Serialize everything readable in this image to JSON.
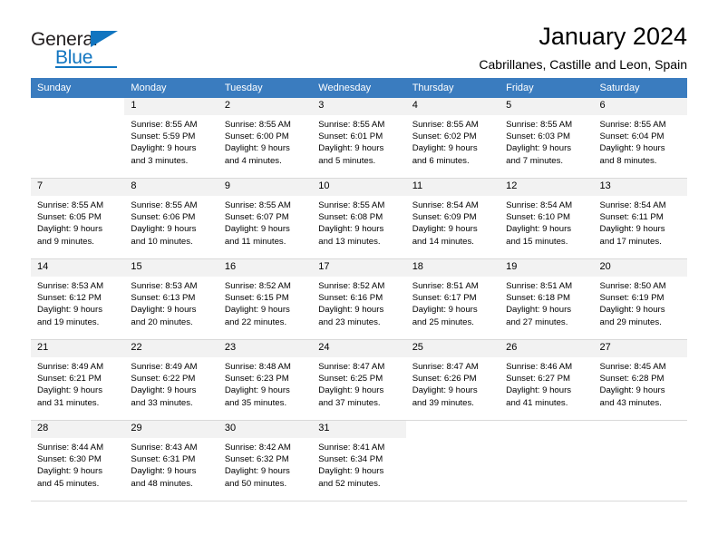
{
  "brand": {
    "name_top": "General",
    "name_bottom": "Blue",
    "accent_color": "#1175c0"
  },
  "header": {
    "title": "January 2024",
    "subtitle": "Cabrillanes, Castille and Leon, Spain"
  },
  "calendar": {
    "header_bg": "#3a7cbf",
    "header_text_color": "#ffffff",
    "weekday_headers": [
      "Sunday",
      "Monday",
      "Tuesday",
      "Wednesday",
      "Thursday",
      "Friday",
      "Saturday"
    ],
    "weeks": [
      [
        {
          "day": "",
          "sunrise": "",
          "sunset": "",
          "daylight_line1": "",
          "daylight_line2": ""
        },
        {
          "day": "1",
          "sunrise": "Sunrise: 8:55 AM",
          "sunset": "Sunset: 5:59 PM",
          "daylight_line1": "Daylight: 9 hours",
          "daylight_line2": "and 3 minutes."
        },
        {
          "day": "2",
          "sunrise": "Sunrise: 8:55 AM",
          "sunset": "Sunset: 6:00 PM",
          "daylight_line1": "Daylight: 9 hours",
          "daylight_line2": "and 4 minutes."
        },
        {
          "day": "3",
          "sunrise": "Sunrise: 8:55 AM",
          "sunset": "Sunset: 6:01 PM",
          "daylight_line1": "Daylight: 9 hours",
          "daylight_line2": "and 5 minutes."
        },
        {
          "day": "4",
          "sunrise": "Sunrise: 8:55 AM",
          "sunset": "Sunset: 6:02 PM",
          "daylight_line1": "Daylight: 9 hours",
          "daylight_line2": "and 6 minutes."
        },
        {
          "day": "5",
          "sunrise": "Sunrise: 8:55 AM",
          "sunset": "Sunset: 6:03 PM",
          "daylight_line1": "Daylight: 9 hours",
          "daylight_line2": "and 7 minutes."
        },
        {
          "day": "6",
          "sunrise": "Sunrise: 8:55 AM",
          "sunset": "Sunset: 6:04 PM",
          "daylight_line1": "Daylight: 9 hours",
          "daylight_line2": "and 8 minutes."
        }
      ],
      [
        {
          "day": "7",
          "sunrise": "Sunrise: 8:55 AM",
          "sunset": "Sunset: 6:05 PM",
          "daylight_line1": "Daylight: 9 hours",
          "daylight_line2": "and 9 minutes."
        },
        {
          "day": "8",
          "sunrise": "Sunrise: 8:55 AM",
          "sunset": "Sunset: 6:06 PM",
          "daylight_line1": "Daylight: 9 hours",
          "daylight_line2": "and 10 minutes."
        },
        {
          "day": "9",
          "sunrise": "Sunrise: 8:55 AM",
          "sunset": "Sunset: 6:07 PM",
          "daylight_line1": "Daylight: 9 hours",
          "daylight_line2": "and 11 minutes."
        },
        {
          "day": "10",
          "sunrise": "Sunrise: 8:55 AM",
          "sunset": "Sunset: 6:08 PM",
          "daylight_line1": "Daylight: 9 hours",
          "daylight_line2": "and 13 minutes."
        },
        {
          "day": "11",
          "sunrise": "Sunrise: 8:54 AM",
          "sunset": "Sunset: 6:09 PM",
          "daylight_line1": "Daylight: 9 hours",
          "daylight_line2": "and 14 minutes."
        },
        {
          "day": "12",
          "sunrise": "Sunrise: 8:54 AM",
          "sunset": "Sunset: 6:10 PM",
          "daylight_line1": "Daylight: 9 hours",
          "daylight_line2": "and 15 minutes."
        },
        {
          "day": "13",
          "sunrise": "Sunrise: 8:54 AM",
          "sunset": "Sunset: 6:11 PM",
          "daylight_line1": "Daylight: 9 hours",
          "daylight_line2": "and 17 minutes."
        }
      ],
      [
        {
          "day": "14",
          "sunrise": "Sunrise: 8:53 AM",
          "sunset": "Sunset: 6:12 PM",
          "daylight_line1": "Daylight: 9 hours",
          "daylight_line2": "and 19 minutes."
        },
        {
          "day": "15",
          "sunrise": "Sunrise: 8:53 AM",
          "sunset": "Sunset: 6:13 PM",
          "daylight_line1": "Daylight: 9 hours",
          "daylight_line2": "and 20 minutes."
        },
        {
          "day": "16",
          "sunrise": "Sunrise: 8:52 AM",
          "sunset": "Sunset: 6:15 PM",
          "daylight_line1": "Daylight: 9 hours",
          "daylight_line2": "and 22 minutes."
        },
        {
          "day": "17",
          "sunrise": "Sunrise: 8:52 AM",
          "sunset": "Sunset: 6:16 PM",
          "daylight_line1": "Daylight: 9 hours",
          "daylight_line2": "and 23 minutes."
        },
        {
          "day": "18",
          "sunrise": "Sunrise: 8:51 AM",
          "sunset": "Sunset: 6:17 PM",
          "daylight_line1": "Daylight: 9 hours",
          "daylight_line2": "and 25 minutes."
        },
        {
          "day": "19",
          "sunrise": "Sunrise: 8:51 AM",
          "sunset": "Sunset: 6:18 PM",
          "daylight_line1": "Daylight: 9 hours",
          "daylight_line2": "and 27 minutes."
        },
        {
          "day": "20",
          "sunrise": "Sunrise: 8:50 AM",
          "sunset": "Sunset: 6:19 PM",
          "daylight_line1": "Daylight: 9 hours",
          "daylight_line2": "and 29 minutes."
        }
      ],
      [
        {
          "day": "21",
          "sunrise": "Sunrise: 8:49 AM",
          "sunset": "Sunset: 6:21 PM",
          "daylight_line1": "Daylight: 9 hours",
          "daylight_line2": "and 31 minutes."
        },
        {
          "day": "22",
          "sunrise": "Sunrise: 8:49 AM",
          "sunset": "Sunset: 6:22 PM",
          "daylight_line1": "Daylight: 9 hours",
          "daylight_line2": "and 33 minutes."
        },
        {
          "day": "23",
          "sunrise": "Sunrise: 8:48 AM",
          "sunset": "Sunset: 6:23 PM",
          "daylight_line1": "Daylight: 9 hours",
          "daylight_line2": "and 35 minutes."
        },
        {
          "day": "24",
          "sunrise": "Sunrise: 8:47 AM",
          "sunset": "Sunset: 6:25 PM",
          "daylight_line1": "Daylight: 9 hours",
          "daylight_line2": "and 37 minutes."
        },
        {
          "day": "25",
          "sunrise": "Sunrise: 8:47 AM",
          "sunset": "Sunset: 6:26 PM",
          "daylight_line1": "Daylight: 9 hours",
          "daylight_line2": "and 39 minutes."
        },
        {
          "day": "26",
          "sunrise": "Sunrise: 8:46 AM",
          "sunset": "Sunset: 6:27 PM",
          "daylight_line1": "Daylight: 9 hours",
          "daylight_line2": "and 41 minutes."
        },
        {
          "day": "27",
          "sunrise": "Sunrise: 8:45 AM",
          "sunset": "Sunset: 6:28 PM",
          "daylight_line1": "Daylight: 9 hours",
          "daylight_line2": "and 43 minutes."
        }
      ],
      [
        {
          "day": "28",
          "sunrise": "Sunrise: 8:44 AM",
          "sunset": "Sunset: 6:30 PM",
          "daylight_line1": "Daylight: 9 hours",
          "daylight_line2": "and 45 minutes."
        },
        {
          "day": "29",
          "sunrise": "Sunrise: 8:43 AM",
          "sunset": "Sunset: 6:31 PM",
          "daylight_line1": "Daylight: 9 hours",
          "daylight_line2": "and 48 minutes."
        },
        {
          "day": "30",
          "sunrise": "Sunrise: 8:42 AM",
          "sunset": "Sunset: 6:32 PM",
          "daylight_line1": "Daylight: 9 hours",
          "daylight_line2": "and 50 minutes."
        },
        {
          "day": "31",
          "sunrise": "Sunrise: 8:41 AM",
          "sunset": "Sunset: 6:34 PM",
          "daylight_line1": "Daylight: 9 hours",
          "daylight_line2": "and 52 minutes."
        },
        {
          "day": "",
          "sunrise": "",
          "sunset": "",
          "daylight_line1": "",
          "daylight_line2": ""
        },
        {
          "day": "",
          "sunrise": "",
          "sunset": "",
          "daylight_line1": "",
          "daylight_line2": ""
        },
        {
          "day": "",
          "sunrise": "",
          "sunset": "",
          "daylight_line1": "",
          "daylight_line2": ""
        }
      ]
    ]
  }
}
